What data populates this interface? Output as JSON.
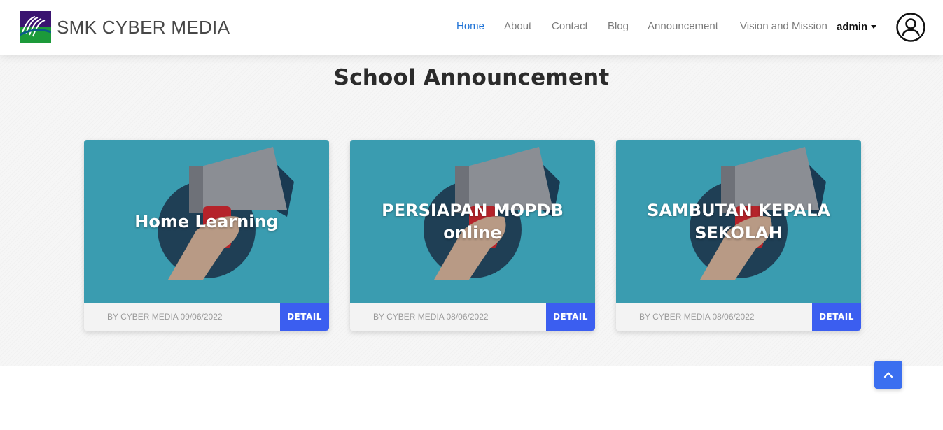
{
  "brand": {
    "name": "SMK CYBER MEDIA",
    "logo_icon": "school-logo-icon"
  },
  "nav": {
    "items": [
      {
        "label": "Home",
        "active": true
      },
      {
        "label": "About",
        "active": false
      },
      {
        "label": "Contact",
        "active": false
      },
      {
        "label": "Blog",
        "active": false
      },
      {
        "label": "Announcement",
        "active": false
      },
      {
        "label": "Vision and Mission",
        "active": false
      }
    ],
    "user_label": "admin",
    "user_icon": "user-circle-icon"
  },
  "section": {
    "title": "School Announcement"
  },
  "cards": [
    {
      "title": "Home Learning",
      "meta": "BY CYBER MEDIA 09/06/2022",
      "button": "DETAIL"
    },
    {
      "title": "PERSIAPAN MOPDB online",
      "meta": "BY CYBER MEDIA 08/06/2022",
      "button": "DETAIL"
    },
    {
      "title": "SAMBUTAN KEPALA SEKOLAH",
      "meta": "BY CYBER MEDIA 08/06/2022",
      "button": "DETAIL"
    }
  ],
  "colors": {
    "accent": "#1f73d6",
    "button": "#3b5ef0",
    "card_bg": "#3b9bb0"
  },
  "scroll_top_icon": "chevron-up-icon"
}
